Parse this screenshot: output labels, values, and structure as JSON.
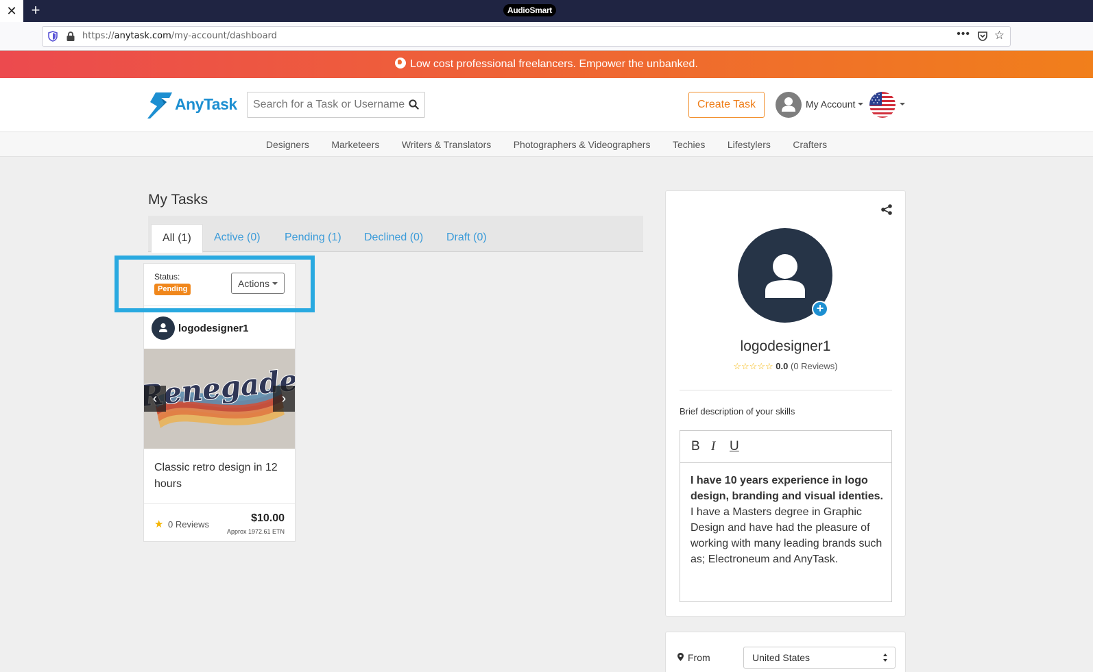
{
  "browser": {
    "badge": "AudioSmart",
    "url_prefix": "https://",
    "url_domain": "anytask.com",
    "url_path": "/my-account/dashboard"
  },
  "promo": {
    "text": "Low cost professional freelancers. Empower the unbanked."
  },
  "header": {
    "logo": "AnyTask",
    "search_placeholder": "Search for a Task or Username",
    "create_task": "Create Task",
    "my_account": "My Account"
  },
  "categories": [
    "Designers",
    "Marketeers",
    "Writers & Translators",
    "Photographers & Videographers",
    "Techies",
    "Lifestylers",
    "Crafters"
  ],
  "main": {
    "title": "My Tasks",
    "tabs": [
      "All (1)",
      "Active (0)",
      "Pending (1)",
      "Declined (0)",
      "Draft (0)"
    ]
  },
  "task": {
    "status_label": "Status:",
    "status": "Pending",
    "actions": "Actions",
    "owner": "logodesigner1",
    "image_text": "Renegade",
    "title": "Classic retro design in 12 hours",
    "reviews": "0 Reviews",
    "price": "$10.00",
    "approx": "Approx 1972.61 ETN"
  },
  "profile": {
    "name": "logodesigner1",
    "rating_value": "0.0",
    "rating_count": "(0 Reviews)",
    "skills_label": "Brief description of your skills",
    "toolbar": {
      "bold": "B",
      "italic": "I",
      "underline": "U"
    },
    "description_bold": "I have 10 years experience in logo design, branding and visual identies.",
    "description": "I have a Masters degree in Graphic Design and have had the pleasure of working with many leading brands such as; Electroneum and AnyTask."
  },
  "location": {
    "label": "From",
    "country": "United States"
  },
  "colors": {
    "accent": "#29a9e0",
    "brand": "#1d8fd1",
    "orange": "#ee7d18"
  }
}
